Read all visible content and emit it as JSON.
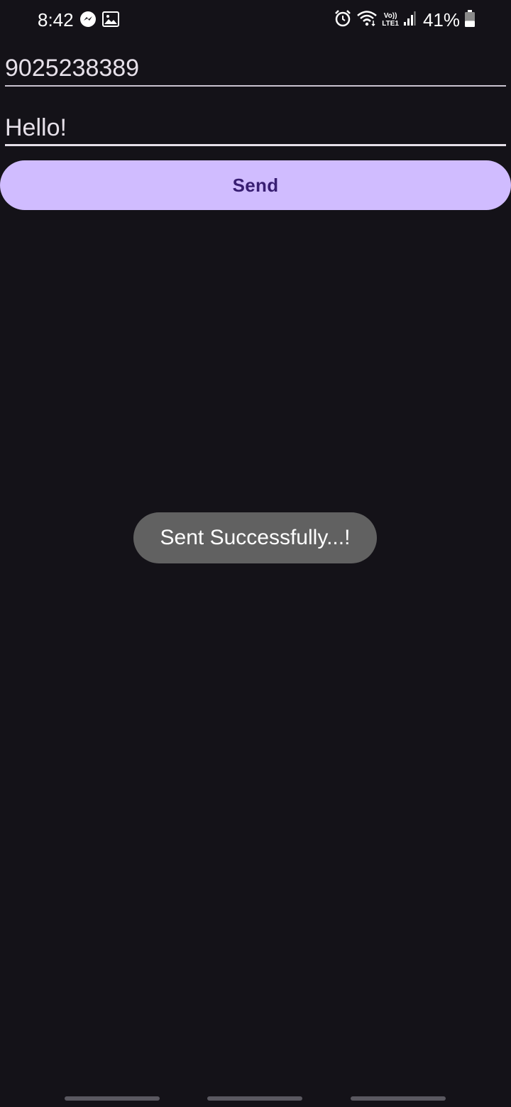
{
  "status_bar": {
    "time": "8:42",
    "left_icons": [
      "messenger-icon",
      "image-icon"
    ],
    "right_icons": [
      "alarm-icon",
      "wifi-icon",
      "volte-icon",
      "signal-icon",
      "battery-icon"
    ],
    "volte_top": "Vo))",
    "volte_bottom": "LTE1",
    "battery": "41%",
    "battery_level": 0.41
  },
  "form": {
    "phone_value": "9025238389",
    "message_value": "Hello!",
    "send_label": "Send"
  },
  "toast": {
    "message": "Sent Successfully...!"
  },
  "colors": {
    "background": "#141218",
    "button": "#d0bcff",
    "button_text": "#381e72",
    "toast": "#616161"
  }
}
